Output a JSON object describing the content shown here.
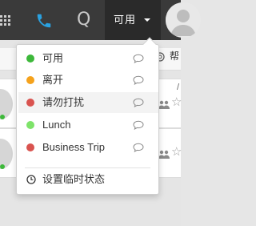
{
  "header": {
    "current_status": "可用",
    "search_letter": "Q"
  },
  "status_menu": {
    "items": [
      {
        "label": "可用",
        "color": "#3db83a"
      },
      {
        "label": "离开",
        "color": "#f5a21c"
      },
      {
        "label": "请勿打扰",
        "color": "#d9534f"
      },
      {
        "label": "Lunch",
        "color": "#7ee36a"
      },
      {
        "label": "Business Trip",
        "color": "#d9534f"
      }
    ],
    "highlighted_index": 2,
    "custom_label": "设置临时状态"
  },
  "background": {
    "help_text": "帮",
    "card_edge_text": "/"
  },
  "icons": {
    "apps": "grid-icon",
    "phone": "phone-icon",
    "message": "speech-bubble-icon",
    "clock": "clock-icon",
    "help": "help-circle-icon",
    "group": "people-icon",
    "favorite": "star-icon"
  }
}
